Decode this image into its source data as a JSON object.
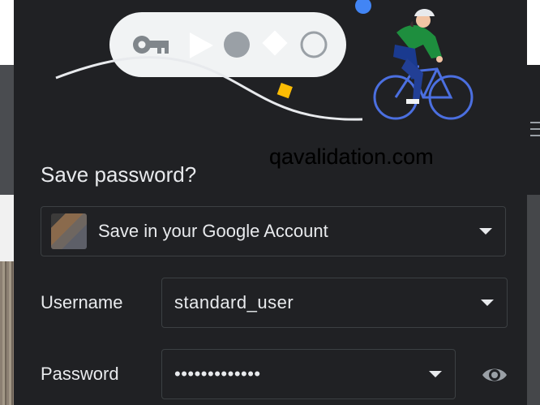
{
  "site": "qavalidation.com",
  "dialog": {
    "title": "Save password?",
    "account_label": "Save in your Google Account",
    "username_label": "Username",
    "username_value": "standard_user",
    "password_label": "Password",
    "password_value": "•••••••••••••"
  },
  "icons": [
    "key-icon",
    "play-icon",
    "circle-icon",
    "diamond-icon",
    "ring-icon",
    "cyclist-illustration",
    "eye-icon",
    "chevron-down-icon"
  ],
  "colors": {
    "bubble_bg": "#202124",
    "text": "#e8eaed",
    "border": "#3c4043",
    "blue_dot": "#4285f4",
    "yellow_square": "#fbbc04",
    "cyclist_jacket": "#1e8e3e"
  }
}
